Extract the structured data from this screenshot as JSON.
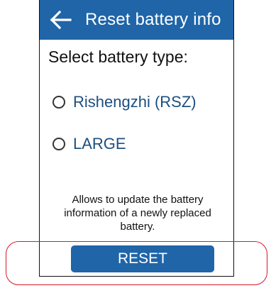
{
  "header": {
    "title": "Reset battery info",
    "back_icon": "arrow-left-icon",
    "background_color": "#1f65a8"
  },
  "prompt": "Select battery type:",
  "battery_options": [
    {
      "label": "Rishengzhi (RSZ)",
      "selected": false
    },
    {
      "label": "LARGE",
      "selected": false
    }
  ],
  "description": "Allows to update the battery information of a newly replaced battery.",
  "reset_button": {
    "label": "RESET",
    "color": "#1f65a8"
  },
  "highlight_color": "#d7192c"
}
